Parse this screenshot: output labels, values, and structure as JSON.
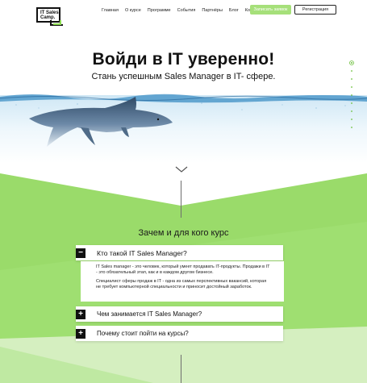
{
  "header": {
    "logo_text": "IT Sales Camp.",
    "nav": [
      "Главная",
      "О курсе",
      "Программе",
      "События",
      "Партнёры",
      "Блог",
      "Контакты"
    ],
    "signup_button": "Записать заявок",
    "register_button": "Регистрация"
  },
  "hero": {
    "title": "Войди в IT уверенно!",
    "subtitle": "Стань успешным Sales Manager в IT- сфере."
  },
  "section": {
    "title": "Зачем и для кого курс"
  },
  "accordion": [
    {
      "sign": "−",
      "question": "Кто такой IT Sales Manager?",
      "answer_p1": "IT Sales manager - это человек, который умеет продавать IT-продукты. Продажи в IT - это обязательный этап, как и в каждом другом бизнесе.",
      "answer_p2": "Специалист сферы продаж в IT - одна из самых перспективных вакансий, которая не требует компьютерной специальности и приносит достойный заработок."
    },
    {
      "sign": "+",
      "question": "Чем занимается IT Sales Manager?"
    },
    {
      "sign": "+",
      "question": "Почему стоит пойти на курсы?"
    }
  ],
  "colors": {
    "accent_green": "#a6e07a",
    "dark": "#111111"
  }
}
